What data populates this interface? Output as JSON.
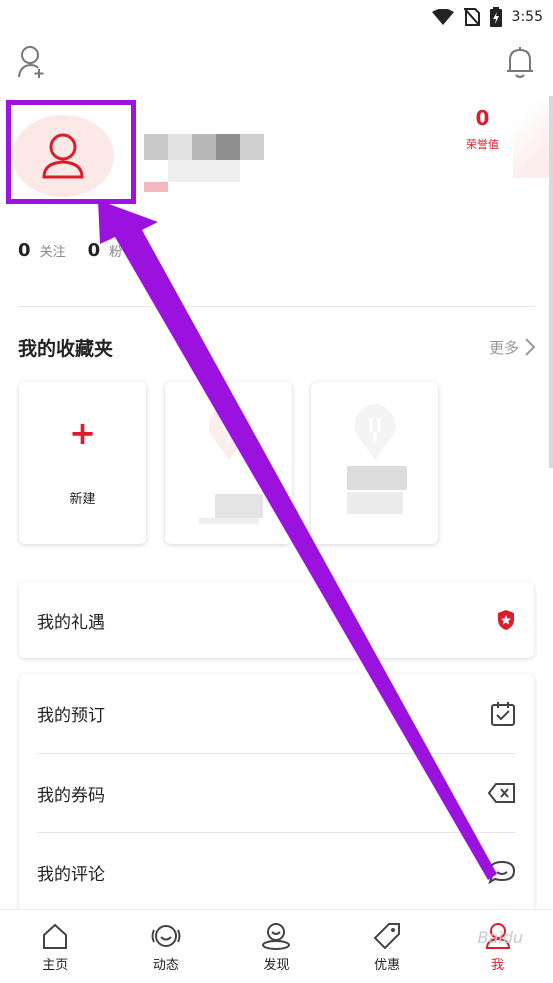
{
  "status_bar": {
    "time": "3:55",
    "icons": [
      "wifi-icon",
      "no-sim-icon",
      "battery-charging-icon"
    ]
  },
  "top_bar": {
    "left_icon": "add-friend-icon",
    "right_icon": "bell-icon"
  },
  "profile": {
    "avatar_icon": "user-icon",
    "honor_value": "0",
    "honor_label": "荣誉值",
    "stats": [
      {
        "value": "0",
        "label": "关注"
      },
      {
        "value": "0",
        "label": "粉"
      }
    ]
  },
  "favorites": {
    "title": "我的收藏夹",
    "more_label": "更多",
    "new_label": "新建",
    "cards": [
      {
        "type": "new",
        "label": "新建"
      },
      {
        "type": "blurred"
      },
      {
        "type": "blurred"
      }
    ]
  },
  "menu": {
    "gift": {
      "label": "我的礼遇",
      "icon": "badge-icon"
    },
    "group": [
      {
        "label": "我的预订",
        "icon": "calendar-check-icon"
      },
      {
        "label": "我的券码",
        "icon": "ticket-icon"
      },
      {
        "label": "我的评论",
        "icon": "comment-icon"
      }
    ]
  },
  "bottom_nav": [
    {
      "label": "主页",
      "icon": "home-icon",
      "active": false
    },
    {
      "label": "动态",
      "icon": "moments-icon",
      "active": false
    },
    {
      "label": "发现",
      "icon": "discover-icon",
      "active": false
    },
    {
      "label": "优惠",
      "icon": "tag-icon",
      "active": false
    },
    {
      "label": "我",
      "icon": "profile-icon",
      "active": true
    }
  ],
  "colors": {
    "accent": "#d81e2c",
    "annotation": "#a012e0"
  },
  "watermark": "Baidu"
}
